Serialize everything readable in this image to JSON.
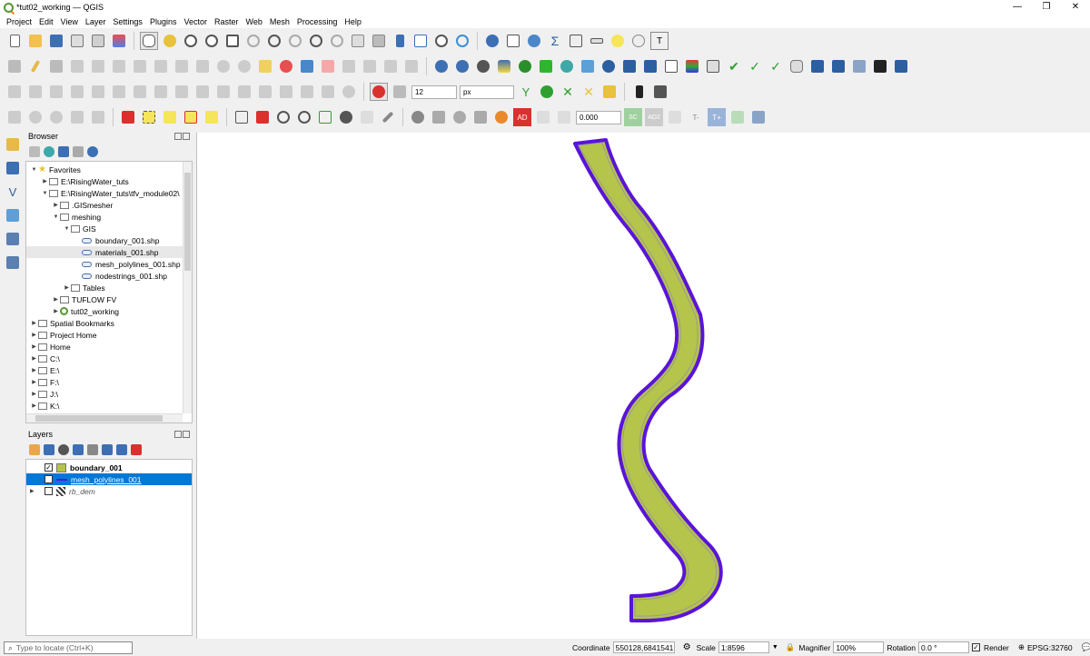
{
  "window": {
    "title": "*tut02_working — QGIS",
    "min": "—",
    "max": "❐",
    "close": "✕"
  },
  "menu": [
    "Project",
    "Edit",
    "View",
    "Layer",
    "Settings",
    "Plugins",
    "Vector",
    "Raster",
    "Web",
    "Mesh",
    "Processing",
    "Help"
  ],
  "snapping": {
    "tolerance": "12",
    "unit": "px"
  },
  "advanced_digitizing": {
    "ad": "AD",
    "value": "0.000",
    "sc": "SC",
    "ad2": "AD2",
    "t": "T-",
    "tplus": "T+"
  },
  "browser": {
    "title": "Browser",
    "items": [
      {
        "label": "Favorites",
        "indent": 0,
        "arrow": "▼",
        "icon": "star"
      },
      {
        "label": "E:\\RisingWater_tuts",
        "indent": 1,
        "arrow": "▶",
        "icon": "folder"
      },
      {
        "label": "E:\\RisingWater_tuts\\tfv_module02\\",
        "indent": 1,
        "arrow": "▼",
        "icon": "folder"
      },
      {
        "label": ".GISmesher",
        "indent": 2,
        "arrow": "▶",
        "icon": "folder"
      },
      {
        "label": "meshing",
        "indent": 2,
        "arrow": "▼",
        "icon": "folder"
      },
      {
        "label": "GIS",
        "indent": 3,
        "arrow": "▼",
        "icon": "folder"
      },
      {
        "label": "boundary_001.shp",
        "indent": 4,
        "arrow": "",
        "icon": "polygon"
      },
      {
        "label": "materials_001.shp",
        "indent": 4,
        "arrow": "",
        "icon": "polygon",
        "selected": true
      },
      {
        "label": "mesh_polylines_001.shp",
        "indent": 4,
        "arrow": "",
        "icon": "polygon"
      },
      {
        "label": "nodestrings_001.shp",
        "indent": 4,
        "arrow": "",
        "icon": "polygon"
      },
      {
        "label": "Tables",
        "indent": 3,
        "arrow": "▶",
        "icon": "folder"
      },
      {
        "label": "TUFLOW FV",
        "indent": 2,
        "arrow": "▶",
        "icon": "folder"
      },
      {
        "label": "tut02_working",
        "indent": 2,
        "arrow": "▶",
        "icon": "qgis"
      },
      {
        "label": "Spatial Bookmarks",
        "indent": 0,
        "arrow": "▶",
        "icon": "folder"
      },
      {
        "label": "Project Home",
        "indent": 0,
        "arrow": "▶",
        "icon": "folder"
      },
      {
        "label": "Home",
        "indent": 0,
        "arrow": "▶",
        "icon": "folder"
      },
      {
        "label": "C:\\",
        "indent": 0,
        "arrow": "▶",
        "icon": "folder"
      },
      {
        "label": "E:\\",
        "indent": 0,
        "arrow": "▶",
        "icon": "folder"
      },
      {
        "label": "F:\\",
        "indent": 0,
        "arrow": "▶",
        "icon": "folder"
      },
      {
        "label": "J:\\",
        "indent": 0,
        "arrow": "▶",
        "icon": "folder"
      },
      {
        "label": "K:\\",
        "indent": 0,
        "arrow": "▶",
        "icon": "folder"
      }
    ]
  },
  "layers": {
    "title": "Layers",
    "items": [
      {
        "label": "boundary_001",
        "checked": true,
        "bold": true,
        "swatch": "#b5c44a"
      },
      {
        "label": "mesh_polylines_001",
        "checked": true,
        "selected": true,
        "swatch": "#5a14d8"
      },
      {
        "label": "rb_dem",
        "checked": false,
        "italic": true,
        "swatch": "#333333"
      }
    ]
  },
  "map": {
    "river_fill": "#b5c44a",
    "river_outline": "#5a14d8",
    "inner_line": "#9a9a9a"
  },
  "status": {
    "locate_placeholder": "Type to locate (Ctrl+K)",
    "coordinate_label": "Coordinate",
    "coordinate_value": "550128,6841541",
    "scale_label": "Scale",
    "scale_value": "1:8596",
    "magnifier_label": "Magnifier",
    "magnifier_value": "100%",
    "rotation_label": "Rotation",
    "rotation_value": "0.0 °",
    "render_label": "Render",
    "crs": "EPSG:32760"
  }
}
